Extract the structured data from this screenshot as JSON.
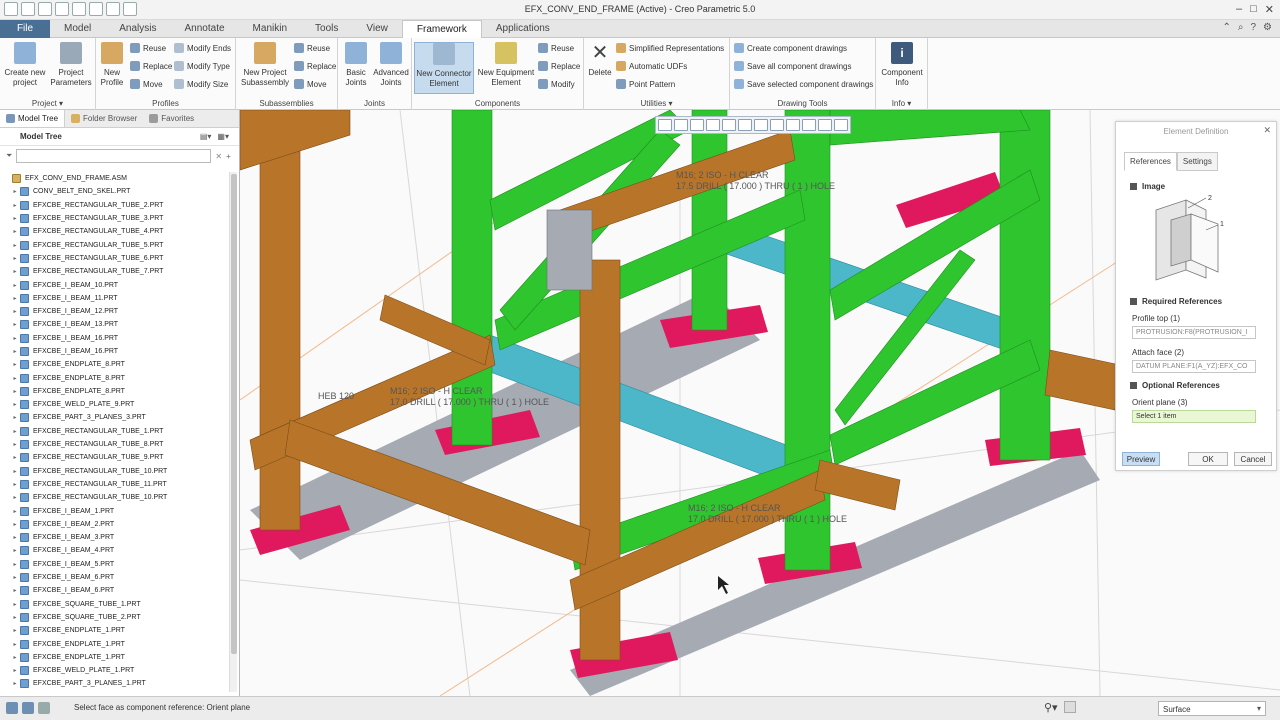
{
  "window": {
    "title": "EFX_CONV_END_FRAME (Active) - Creo Parametric 5.0",
    "controls": [
      "–",
      "□",
      "✕"
    ]
  },
  "tabs": [
    "File",
    "Model",
    "Analysis",
    "Annotate",
    "Manikin",
    "Tools",
    "View",
    "Framework",
    "Applications"
  ],
  "active_tab": "Framework",
  "ribbon": {
    "project": {
      "title": "Project",
      "create_new": [
        "Create new",
        "project"
      ],
      "params": [
        "Project",
        "Parameters"
      ]
    },
    "profiles": {
      "title": "Profiles",
      "new_profile": [
        "New",
        "Profile"
      ],
      "reuse": "Reuse",
      "replace": "Replace",
      "move": "Move",
      "modify_ends": "Modify Ends",
      "modify_type": "Modify Type",
      "modify_size": "Modify Size"
    },
    "subassemblies": {
      "title": "Subassemblies",
      "new_project": [
        "New Project",
        "Subassembly"
      ],
      "reuse": "Reuse",
      "replace": "Replace",
      "move": "Move"
    },
    "joints": {
      "title": "Joints",
      "basic": [
        "Basic",
        "Joints"
      ],
      "advanced": [
        "Advanced",
        "Joints"
      ]
    },
    "components": {
      "title": "Components",
      "new_connector": [
        "New Connector",
        "Element"
      ],
      "new_equipment": [
        "New Equipment",
        "Element"
      ],
      "reuse": "Reuse",
      "replace": "Replace",
      "modify": "Modify"
    },
    "utilities": {
      "title": "Utilities",
      "delete": "Delete",
      "simplified": "Simplified Representations",
      "auto_udfs": "Automatic UDFs",
      "point_pattern": "Point Pattern"
    },
    "drawing_tools": {
      "title": "Drawing Tools",
      "create": "Create component drawings",
      "save_all": "Save all component drawings",
      "save_selected": "Save selected component drawings"
    },
    "info": {
      "title": "Info",
      "component_info": [
        "Component",
        "Info"
      ]
    }
  },
  "nav": {
    "tabs": [
      "Model Tree",
      "Folder Browser",
      "Favorites"
    ],
    "tree_header": "Model Tree",
    "items": [
      "EFX_CONV_END_FRAME.ASM",
      "CONV_BELT_END_SKEL.PRT",
      "EFXCBE_RECTANGULAR_TUBE_2.PRT",
      "EFXCBE_RECTANGULAR_TUBE_3.PRT",
      "EFXCBE_RECTANGULAR_TUBE_4.PRT",
      "EFXCBE_RECTANGULAR_TUBE_5.PRT",
      "EFXCBE_RECTANGULAR_TUBE_6.PRT",
      "EFXCBE_RECTANGULAR_TUBE_7.PRT",
      "EFXCBE_I_BEAM_10.PRT",
      "EFXCBE_I_BEAM_11.PRT",
      "EFXCBE_I_BEAM_12.PRT",
      "EFXCBE_I_BEAM_13.PRT",
      "EFXCBE_I_BEAM_16.PRT",
      "EFXCBE_I_BEAM_16.PRT",
      "EFXCBE_ENDPLATE_8.PRT",
      "EFXCBE_ENDPLATE_8.PRT",
      "EFXCBE_ENDPLATE_8.PRT",
      "EFXCBE_WELD_PLATE_9.PRT",
      "EFXCBE_PART_3_PLANES_3.PRT",
      "EFXCBE_RECTANGULAR_TUBE_1.PRT",
      "EFXCBE_RECTANGULAR_TUBE_8.PRT",
      "EFXCBE_RECTANGULAR_TUBE_9.PRT",
      "EFXCBE_RECTANGULAR_TUBE_10.PRT",
      "EFXCBE_RECTANGULAR_TUBE_11.PRT",
      "EFXCBE_RECTANGULAR_TUBE_10.PRT",
      "EFXCBE_I_BEAM_1.PRT",
      "EFXCBE_I_BEAM_2.PRT",
      "EFXCBE_I_BEAM_3.PRT",
      "EFXCBE_I_BEAM_4.PRT",
      "EFXCBE_I_BEAM_5.PRT",
      "EFXCBE_I_BEAM_6.PRT",
      "EFXCBE_I_BEAM_6.PRT",
      "EFXCBE_SQUARE_TUBE_1.PRT",
      "EFXCBE_SQUARE_TUBE_2.PRT",
      "EFXCBE_ENDPLATE_1.PRT",
      "EFXCBE_ENDPLATE_1.PRT",
      "EFXCBE_ENDPLATE_1.PRT",
      "EFXCBE_WELD_PLATE_1.PRT",
      "EFXCBE_PART_3_PLANES_1.PRT"
    ]
  },
  "viewport": {
    "annotations": [
      "M16; 2 ISO - H CLEAR",
      "17.5 DRILL ( 17.000 ) THRU ( 1 ) HOLE",
      "HEB 120",
      "M16; 2 ISO - H CLEAR",
      "17.0 DRILL ( 17.000 ) THRU ( 1 ) HOLE",
      "M16; 2 ISO - H CLEAR",
      "17.0 DRILL ( 17.000 ) THRU ( 1 ) HOLE"
    ],
    "colors": {
      "green": "#2fc52f",
      "brown": "#b8752a",
      "cyan": "#4bb7c9",
      "magenta": "#e0195e",
      "gray_plate": "#a5aab3"
    }
  },
  "element_definition": {
    "title": "Element Definition",
    "tabs": [
      "References",
      "Settings"
    ],
    "image_section": "Image",
    "image_callouts": [
      "2",
      "1"
    ],
    "required_section": "Required References",
    "profile_top_label": "Profile top (1)",
    "profile_top_value": "PROTRUSION:F8(PROTRUSION_I",
    "attach_face_label": "Attach face (2)",
    "attach_face_value": "DATUM PLANE:F1(A_YZ):EFX_CO",
    "optional_section": "Optional References",
    "orient_plane_label": "Orient plane (3)",
    "orient_plane_value": "Select 1 item",
    "preview": "Preview",
    "ok": "OK",
    "cancel": "Cancel"
  },
  "statusbar": {
    "message": "Select face as component reference: Orient plane",
    "filter": "Surface"
  }
}
